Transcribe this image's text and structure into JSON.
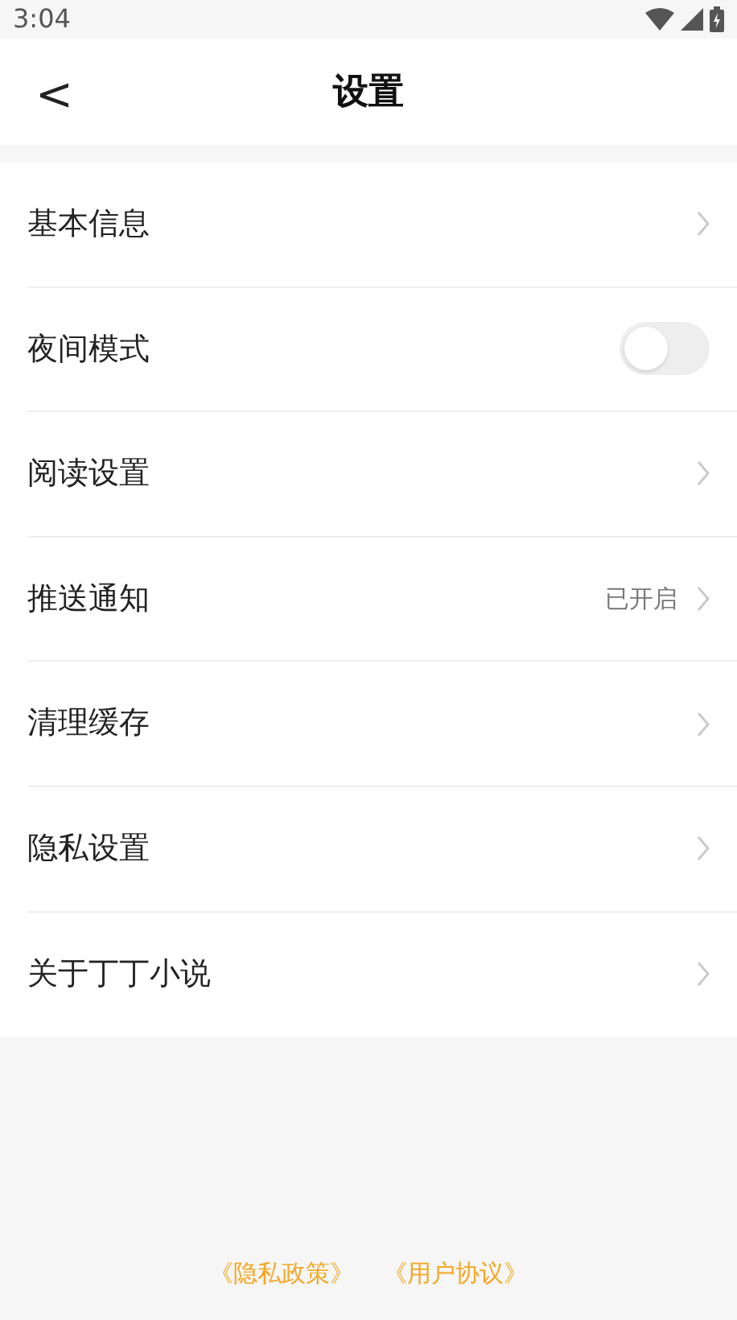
{
  "status_bar": {
    "time": "3:04"
  },
  "header": {
    "back": "<",
    "title": "设置"
  },
  "items": [
    {
      "kind": "link",
      "label": "基本信息"
    },
    {
      "kind": "toggle",
      "label": "夜间模式",
      "on": false
    },
    {
      "kind": "link",
      "label": "阅读设置"
    },
    {
      "kind": "link",
      "label": "推送通知",
      "value": "已开启"
    },
    {
      "kind": "link",
      "label": "清理缓存"
    },
    {
      "kind": "link",
      "label": "隐私设置"
    },
    {
      "kind": "link",
      "label": "关于丁丁小说"
    }
  ],
  "footer_links": [
    "《隐私政策》",
    "《用户协议》"
  ]
}
